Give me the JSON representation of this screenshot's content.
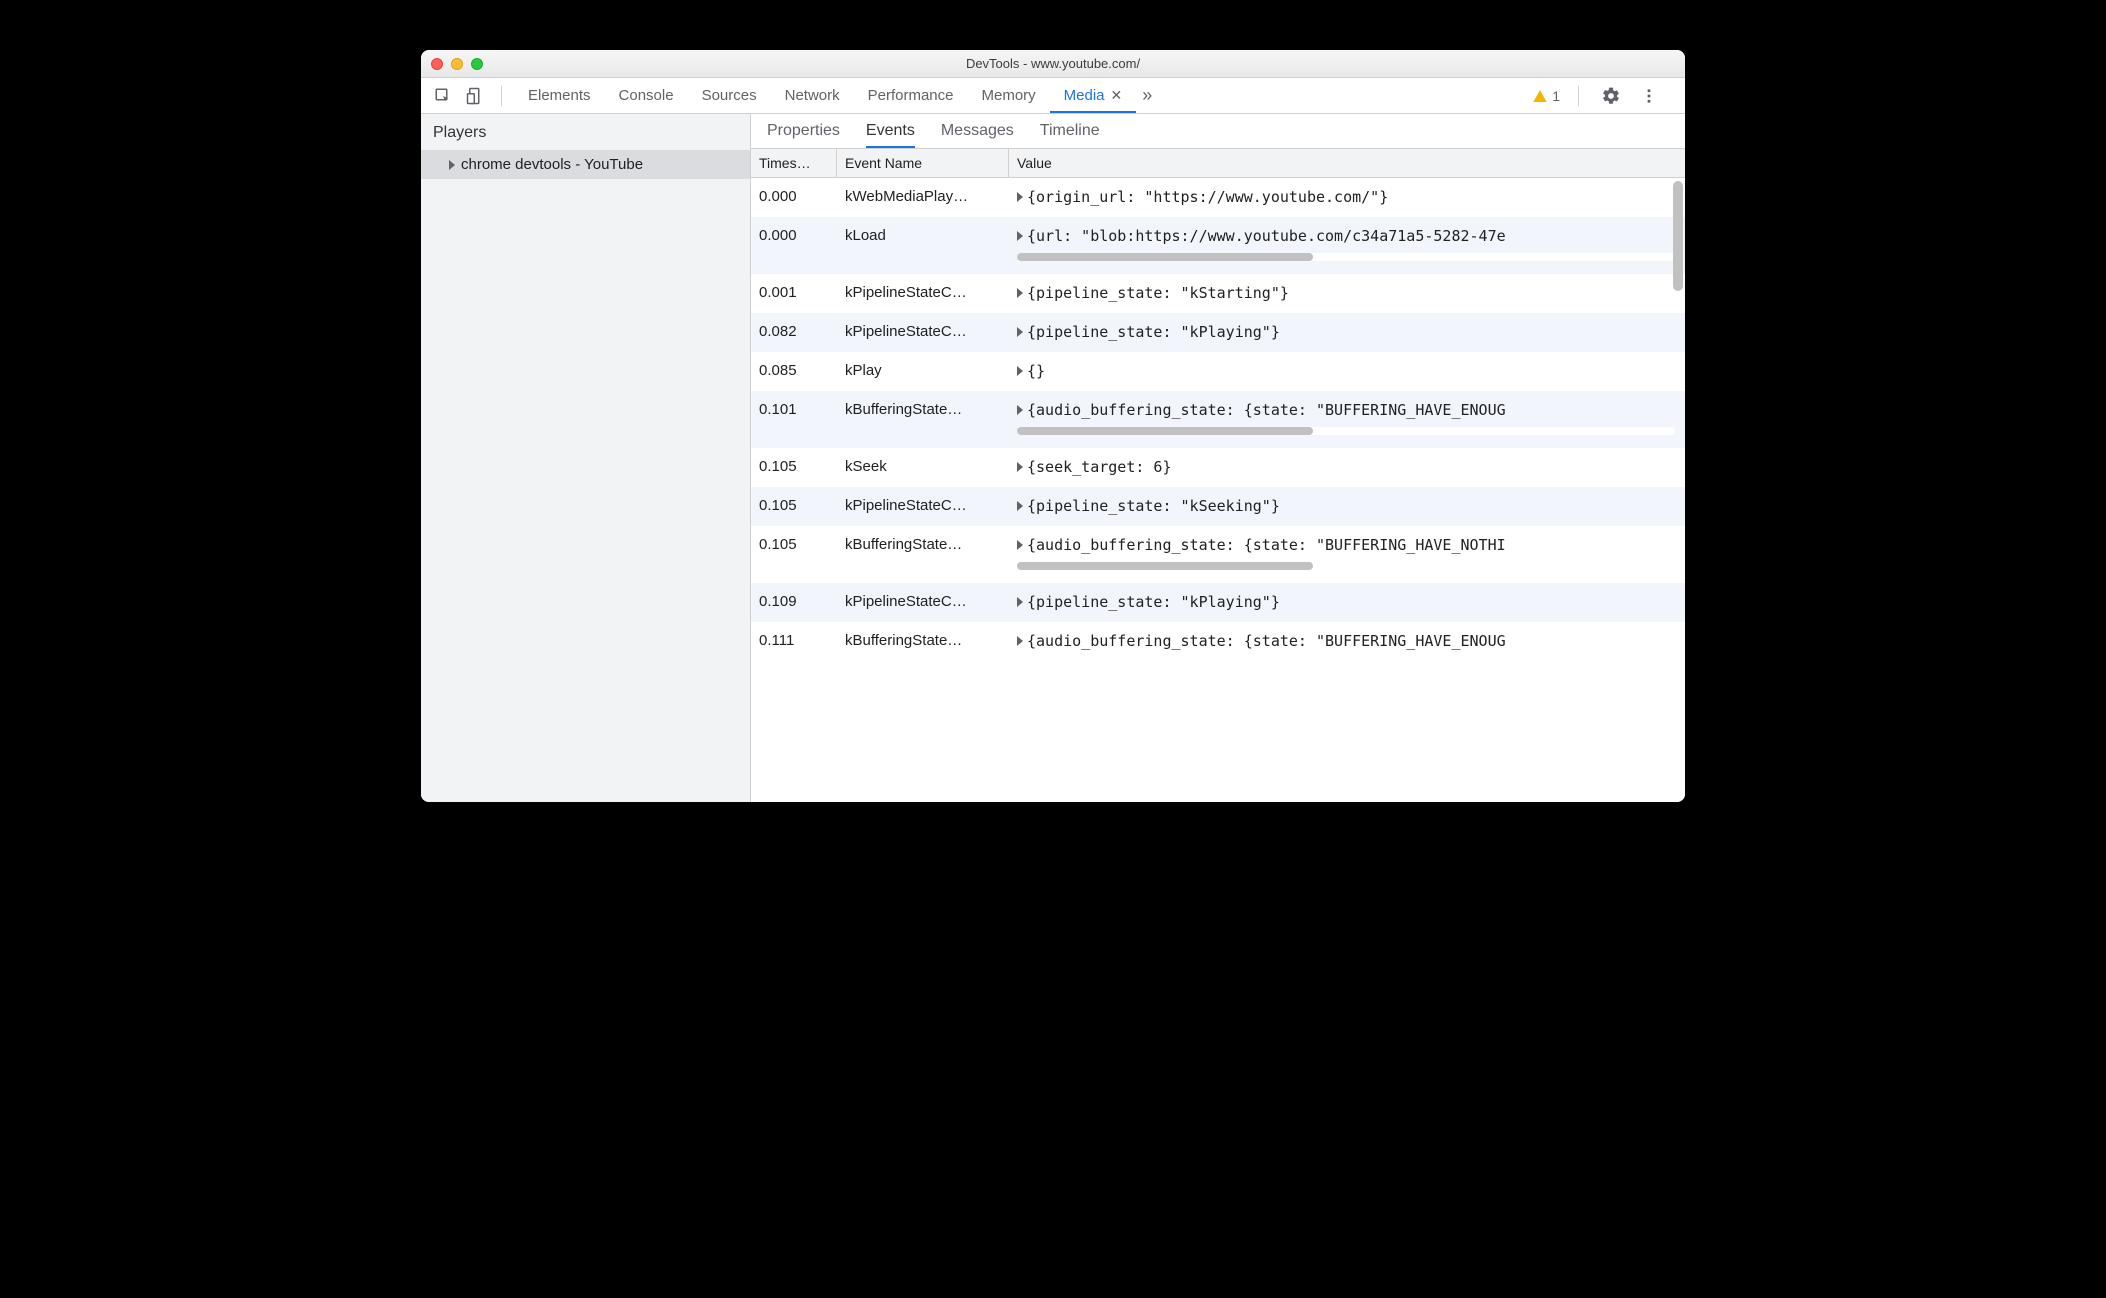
{
  "window": {
    "title": "DevTools - www.youtube.com/"
  },
  "toolbar": {
    "tabs": [
      "Elements",
      "Console",
      "Sources",
      "Network",
      "Performance",
      "Memory"
    ],
    "active_tab": "Media",
    "warnings": "1"
  },
  "sidebar": {
    "title": "Players",
    "players": [
      {
        "label": "chrome devtools - YouTube"
      }
    ]
  },
  "subtabs": {
    "items": [
      "Properties",
      "Events",
      "Messages",
      "Timeline"
    ],
    "active": "Events"
  },
  "table": {
    "headers": {
      "ts": "Times…",
      "event": "Event Name",
      "value": "Value"
    },
    "rows": [
      {
        "ts": "0.000",
        "event": "kWebMediaPlay…",
        "value": "{origin_url: \"https://www.youtube.com/\"}",
        "overflow": false
      },
      {
        "ts": "0.000",
        "event": "kLoad",
        "value": "{url: \"blob:https://www.youtube.com/c34a71a5-5282-47e",
        "overflow": true
      },
      {
        "ts": "0.001",
        "event": "kPipelineStateC…",
        "value": "{pipeline_state: \"kStarting\"}",
        "overflow": false
      },
      {
        "ts": "0.082",
        "event": "kPipelineStateC…",
        "value": "{pipeline_state: \"kPlaying\"}",
        "overflow": false
      },
      {
        "ts": "0.085",
        "event": "kPlay",
        "value": "{}",
        "overflow": false
      },
      {
        "ts": "0.101",
        "event": "kBufferingState…",
        "value": "{audio_buffering_state: {state: \"BUFFERING_HAVE_ENOUG",
        "overflow": true
      },
      {
        "ts": "0.105",
        "event": "kSeek",
        "value": "{seek_target: 6}",
        "overflow": false
      },
      {
        "ts": "0.105",
        "event": "kPipelineStateC…",
        "value": "{pipeline_state: \"kSeeking\"}",
        "overflow": false
      },
      {
        "ts": "0.105",
        "event": "kBufferingState…",
        "value": "{audio_buffering_state: {state: \"BUFFERING_HAVE_NOTHI",
        "overflow": true
      },
      {
        "ts": "0.109",
        "event": "kPipelineStateC…",
        "value": "{pipeline_state: \"kPlaying\"}",
        "overflow": false
      },
      {
        "ts": "0.111",
        "event": "kBufferingState…",
        "value": "{audio_buffering_state: {state: \"BUFFERING_HAVE_ENOUG",
        "overflow": false
      }
    ]
  }
}
